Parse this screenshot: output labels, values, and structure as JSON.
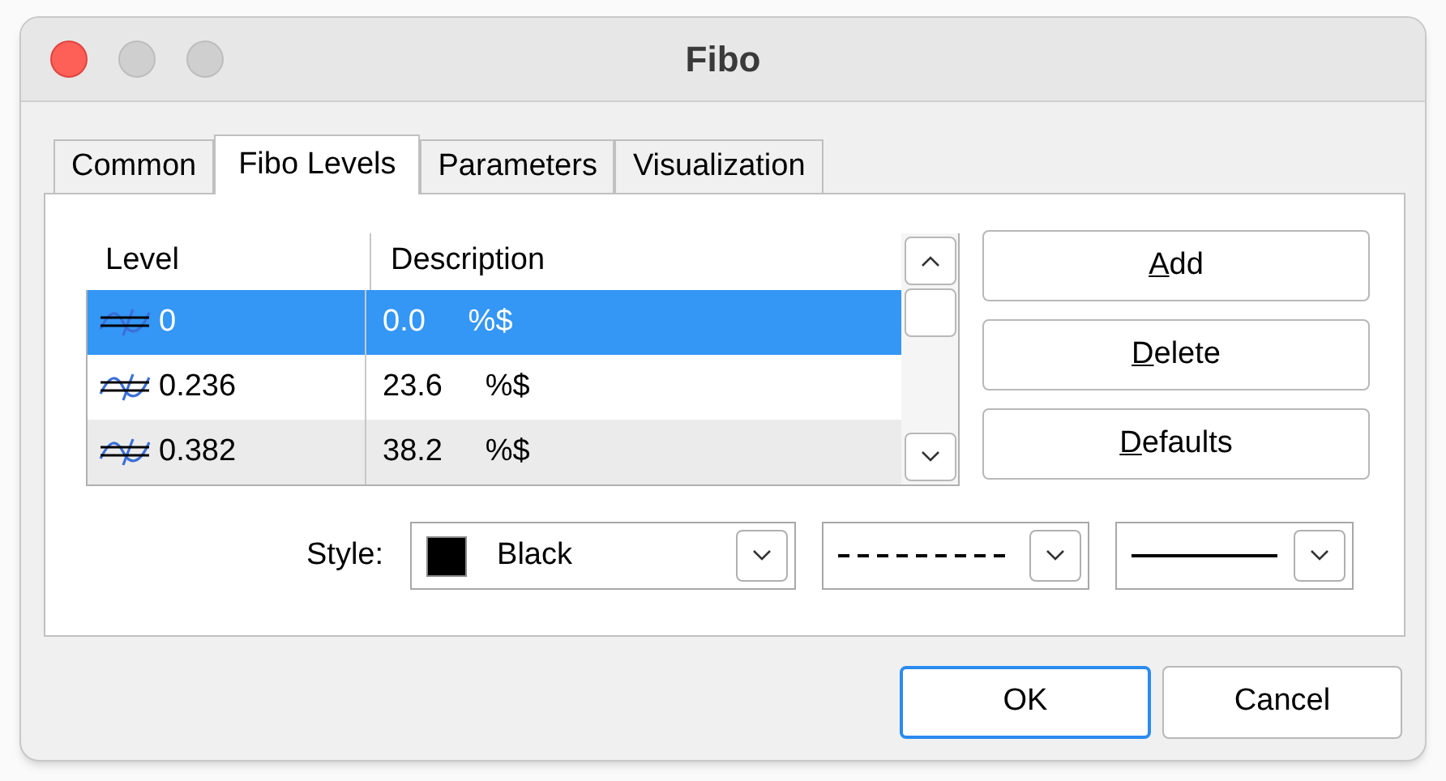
{
  "window": {
    "title": "Fibo"
  },
  "tabs": [
    {
      "label": "Common",
      "selected": false
    },
    {
      "label": "Fibo Levels",
      "selected": true
    },
    {
      "label": "Parameters",
      "selected": false
    },
    {
      "label": "Visualization",
      "selected": false
    }
  ],
  "table": {
    "columns": [
      "Level",
      "Description"
    ],
    "rows": [
      {
        "level": "0",
        "description": "0.0     %$",
        "selected": true,
        "hovered": false
      },
      {
        "level": "0.236",
        "description": "23.6     %$",
        "selected": false,
        "hovered": false
      },
      {
        "level": "0.382",
        "description": "38.2     %$",
        "selected": false,
        "hovered": true
      }
    ]
  },
  "side_buttons": [
    "Add",
    "Delete",
    "Defaults"
  ],
  "style": {
    "label": "Style:",
    "dropdowns": [
      {
        "kind": "color",
        "color": "#000000",
        "value": "Black"
      },
      {
        "kind": "dashed"
      },
      {
        "kind": "solid"
      }
    ]
  },
  "buttons": [
    {
      "label": "OK",
      "default": true
    },
    {
      "label": "Cancel",
      "default": false
    }
  ]
}
